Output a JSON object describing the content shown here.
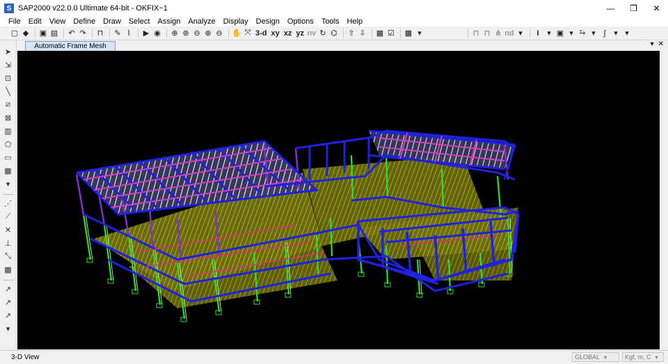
{
  "window": {
    "title": "SAP2000 v22.0.0 Ultimate 64-bit - OKFIX~1",
    "icon_label": "S",
    "minimize": "—",
    "restore": "❐",
    "close": "✕"
  },
  "menu": [
    "File",
    "Edit",
    "View",
    "Define",
    "Draw",
    "Select",
    "Assign",
    "Analyze",
    "Display",
    "Design",
    "Options",
    "Tools",
    "Help"
  ],
  "toolbar": {
    "view_buttons": [
      "3-d",
      "xy",
      "xz",
      "yz",
      "nv"
    ],
    "nd_label": "nd"
  },
  "tab": {
    "label": "Automatic Frame Mesh",
    "ctrl_dropdown": "▾",
    "ctrl_close": "✕"
  },
  "status": {
    "view_label": "3-D View",
    "coord_system": "GLOBAL",
    "units": "Kgf, m, C"
  },
  "colors": {
    "beam_blue": "#2020e0",
    "beam_magenta": "#d040c0",
    "column_green": "#30e030",
    "column_purple": "#8030d0",
    "slab_yellow": "#c8c800",
    "slab_hatch": "#ffffff",
    "viewport_bg": "#000000"
  }
}
